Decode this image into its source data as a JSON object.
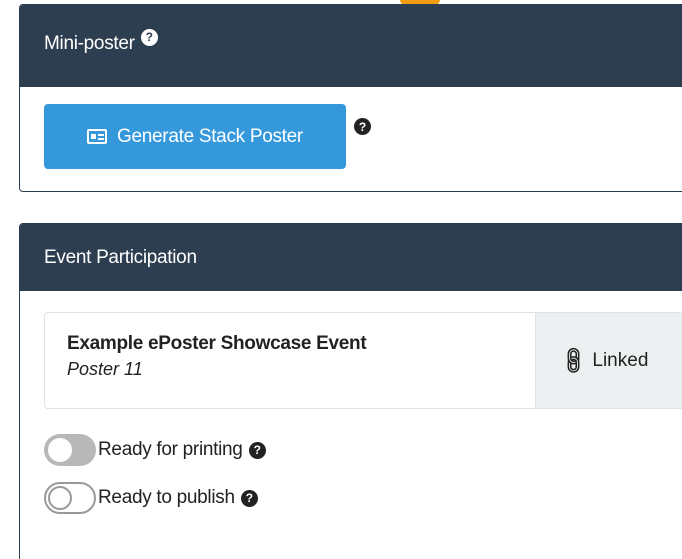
{
  "miniposter": {
    "title": "Mini-poster",
    "help_icon": "question-circle-icon",
    "generate_button": {
      "label": "Generate Stack Poster",
      "icon": "id-card-icon",
      "color": "#3498db"
    }
  },
  "event": {
    "title": "Event Participation",
    "item": {
      "name": "Example ePoster Showcase Event",
      "poster": "Poster 11",
      "status": "Linked",
      "status_icon": "link-icon"
    },
    "toggles": [
      {
        "label": "Ready for printing",
        "on": false
      },
      {
        "label": "Ready to publish",
        "on": false
      }
    ]
  },
  "colors": {
    "header_bg": "#2c3e50",
    "accent": "#3498db",
    "status_bg": "#ecf0f1"
  }
}
